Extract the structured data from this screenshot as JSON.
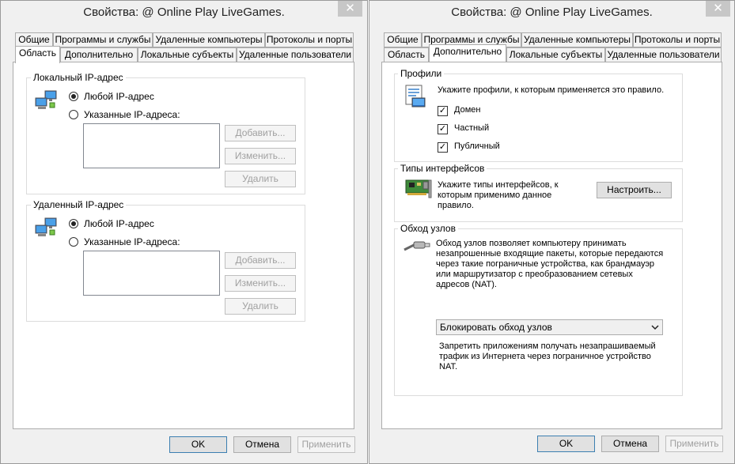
{
  "left": {
    "title": "Свойства: @ Online Play LiveGames.",
    "close_glyph": "✕",
    "tabs_row1": [
      "Общие",
      "Программы и службы",
      "Удаленные компьютеры",
      "Протоколы и порты"
    ],
    "tabs_row2": [
      "Область",
      "Дополнительно",
      "Локальные субъекты",
      "Удаленные пользователи"
    ],
    "active_tab": "Область",
    "local": {
      "legend": "Локальный IP-адрес",
      "any": "Любой IP-адрес",
      "specified": "Указанные IP-адреса:",
      "add": "Добавить...",
      "edit": "Изменить...",
      "remove": "Удалить",
      "selected": "any"
    },
    "remote": {
      "legend": "Удаленный IP-адрес",
      "any": "Любой IP-адрес",
      "specified": "Указанные IP-адреса:",
      "add": "Добавить...",
      "edit": "Изменить...",
      "remove": "Удалить",
      "selected": "any"
    },
    "buttons": {
      "ok": "OK",
      "cancel": "Отмена",
      "apply": "Применить"
    }
  },
  "right": {
    "title": "Свойства: @ Online Play LiveGames.",
    "close_glyph": "✕",
    "tabs_row1": [
      "Общие",
      "Программы и службы",
      "Удаленные компьютеры",
      "Протоколы и порты"
    ],
    "tabs_row2": [
      "Область",
      "Дополнительно",
      "Локальные субъекты",
      "Удаленные пользователи"
    ],
    "active_tab": "Дополнительно",
    "profiles": {
      "legend": "Профили",
      "desc": "Укажите профили, к которым применяется это правило.",
      "items": [
        {
          "label": "Домен",
          "checked": true
        },
        {
          "label": "Частный",
          "checked": true
        },
        {
          "label": "Публичный",
          "checked": true
        }
      ]
    },
    "interfaces": {
      "legend": "Типы интерфейсов",
      "desc_lines": [
        "Укажите типы интерфейсов, к",
        "которым применимо данное",
        "правило."
      ],
      "button": "Настроить..."
    },
    "traversal": {
      "legend": "Обход узлов",
      "desc_lines": [
        "Обход узлов позволяет компьютеру принимать",
        "незапрошенные входящие пакеты, которые передаются",
        "через такие пограничные устройства, как брандмауэр",
        "или маршрутизатор с преобразованием сетевых",
        "адресов (NAT)."
      ],
      "select_value": "Блокировать обход узлов",
      "note_lines": [
        "Запретить приложениям получать незапрашиваемый",
        "трафик из Интернета через пограничное устройство",
        "NAT."
      ]
    },
    "buttons": {
      "ok": "OK",
      "cancel": "Отмена",
      "apply": "Применить"
    }
  },
  "icons": {
    "network": "network-computers-icon",
    "profile": "profile-computer-icon",
    "nic": "network-card-icon",
    "cable": "network-cable-icon",
    "chevron": "chevron-down-icon"
  }
}
